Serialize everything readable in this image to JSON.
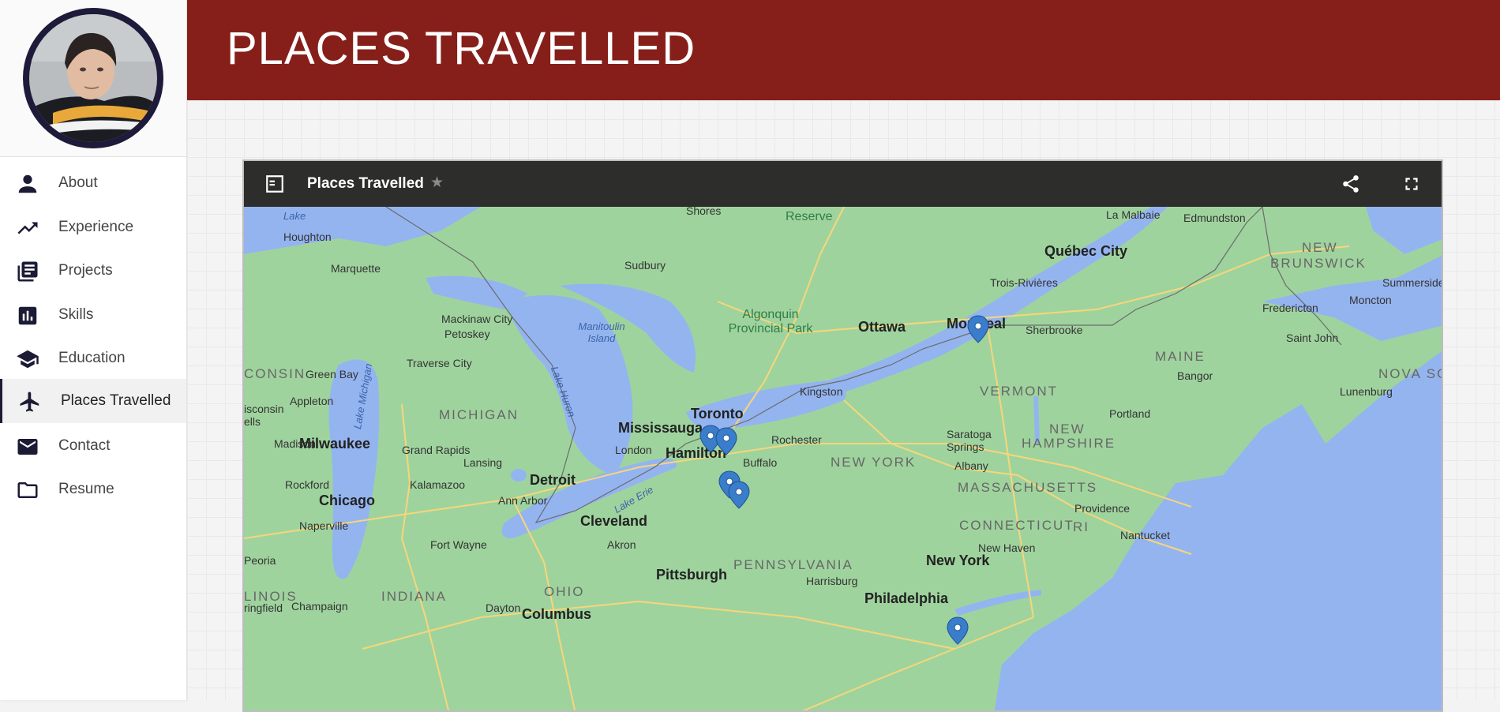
{
  "sidebar": {
    "items": [
      {
        "label": "About",
        "icon": "person-icon"
      },
      {
        "label": "Experience",
        "icon": "trending-up-icon"
      },
      {
        "label": "Projects",
        "icon": "library-books-icon"
      },
      {
        "label": "Skills",
        "icon": "bar-chart-icon"
      },
      {
        "label": "Education",
        "icon": "school-icon"
      },
      {
        "label": "Places Travelled",
        "icon": "airplane-icon",
        "active": true
      },
      {
        "label": "Contact",
        "icon": "mail-icon"
      },
      {
        "label": "Resume",
        "icon": "folder-icon"
      }
    ]
  },
  "header": {
    "title": "PLACES TRAVELLED"
  },
  "map_embed": {
    "title": "Places Travelled",
    "star": "★",
    "labels": {
      "houghton": "Houghton",
      "marquette": "Marquette",
      "sudbury": "Sudbury",
      "shores": "Shores",
      "reserve": "Reserve",
      "la_malbaie": "La Malbaie",
      "edmundston": "Edmundston",
      "quebec_city": "Québec City",
      "new_brunswick_1": "NEW",
      "new_brunswick_2": "BRUNSWICK",
      "summerside": "Summerside",
      "trois_rivieres": "Trois-Rivières",
      "fredericton": "Fredericton",
      "moncton": "Moncton",
      "mackinaw_city": "Mackinaw City",
      "manitoulin": "Manitoulin Island",
      "algonquin": "Algonquin Provincial Park",
      "ottawa": "Ottawa",
      "montreal": "Montreal",
      "sherbrooke": "Sherbrooke",
      "saint_john": "Saint John",
      "petoskey": "Petoskey",
      "maine": "MAINE",
      "traverse_city": "Traverse City",
      "lake_huron": "Lake Huron",
      "green_bay": "Green Bay",
      "consin": "CONSIN",
      "bangor": "Bangor",
      "nova_scotia": "NOVA SC",
      "kingston": "Kingston",
      "vermont": "VERMONT",
      "appleton": "Appleton",
      "lake_michigan": "Lake Michigan",
      "lunenburg": "Lunenburg",
      "michigan": "MICHIGAN",
      "toronto": "Toronto",
      "portland": "Portland",
      "mississauga": "Mississauga",
      "saratoga": "Saratoga Springs",
      "new_hampshire_1": "NEW",
      "new_hampshire_2": "HAMPSHIRE",
      "madison": "Madison",
      "milwaukee": "Milwaukee",
      "grand_rapids": "Grand Rapids",
      "london": "London",
      "hamilton": "Hamilton",
      "rochester": "Rochester",
      "new_york_state": "NEW YORK",
      "lansing": "Lansing",
      "buffalo": "Buffalo",
      "detroit": "Detroit",
      "albany": "Albany",
      "rockford": "Rockford",
      "kalamazoo": "Kalamazoo",
      "massachusetts": "MASSACHUSETTS",
      "chicago": "Chicago",
      "ann_arbor": "Ann Arbor",
      "lake_erie": "Lake Erie",
      "providence": "Providence",
      "naperville": "Naperville",
      "cleveland": "Cleveland",
      "connecticut": "CONNECTICUT",
      "ri": "RI",
      "nantucket": "Nantucket",
      "fort_wayne": "Fort Wayne",
      "akron": "Akron",
      "new_haven": "New Haven",
      "new_york": "New York",
      "peoria": "Peoria",
      "pennsylvania": "PENNSYLVANIA",
      "pittsburgh": "Pittsburgh",
      "harrisburg": "Harrisburg",
      "ohio": "OHIO",
      "linois": "LINOIS",
      "indiana": "INDIANA",
      "philadelphia": "Philadelphia",
      "ringfield": "ringfield",
      "champaign": "Champaign",
      "dayton": "Dayton",
      "columbus": "Columbus",
      "wisconsin_ells_1": "isconsin",
      "wisconsin_ells_2": "ells",
      "lake": "Lake"
    },
    "colors": {
      "land": "#9fd39e",
      "water": "#94b4f0",
      "roads": "#f7d67a",
      "pin": "#3a7dca"
    }
  },
  "colors": {
    "banner": "#861f1a",
    "sidebar_accent": "#1c1b35"
  }
}
